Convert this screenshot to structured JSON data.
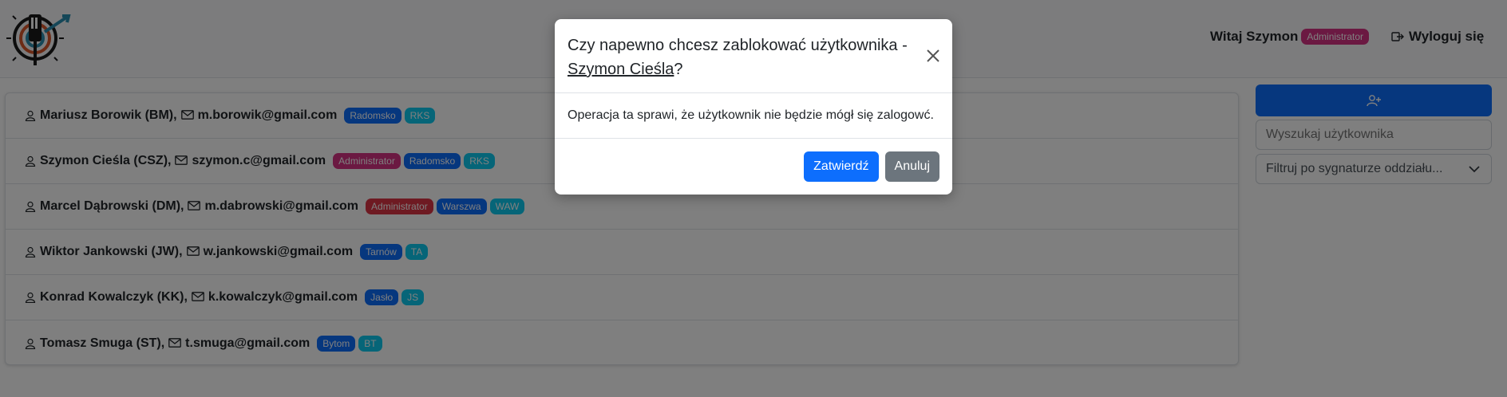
{
  "header": {
    "greeting": "Witaj Szymon",
    "role_badge": "Administrator",
    "logout_label": "Wyloguj się"
  },
  "users": [
    {
      "label": "Mariusz Borowik (BM),",
      "email": "m.borowik@gmail.com",
      "badges": [
        {
          "text": "Radomsko",
          "kind": "city"
        },
        {
          "text": "RKS",
          "kind": "code"
        }
      ]
    },
    {
      "label": "Szymon Cieśla (CSZ),",
      "email": "szymon.c@gmail.com",
      "badges": [
        {
          "text": "Administrator",
          "kind": "admin"
        },
        {
          "text": "Radomsko",
          "kind": "city"
        },
        {
          "text": "RKS",
          "kind": "code"
        }
      ]
    },
    {
      "label": "Marcel Dąbrowski (DM),",
      "email": "m.dabrowski@gmail.com",
      "badges": [
        {
          "text": "Administrator",
          "kind": "admin2"
        },
        {
          "text": "Warszwa",
          "kind": "city"
        },
        {
          "text": "WAW",
          "kind": "code"
        }
      ]
    },
    {
      "label": "Wiktor Jankowski (JW),",
      "email": "w.jankowski@gmail.com",
      "badges": [
        {
          "text": "Tarnów",
          "kind": "city"
        },
        {
          "text": "TA",
          "kind": "code"
        }
      ]
    },
    {
      "label": "Konrad Kowalczyk (KK),",
      "email": "k.kowalczyk@gmail.com",
      "badges": [
        {
          "text": "Jasło",
          "kind": "city"
        },
        {
          "text": "JS",
          "kind": "code"
        }
      ]
    },
    {
      "label": "Tomasz Smuga (ST),",
      "email": "t.smuga@gmail.com",
      "badges": [
        {
          "text": "Bytom",
          "kind": "city"
        },
        {
          "text": "BT",
          "kind": "code"
        }
      ]
    }
  ],
  "sidebar": {
    "add_icon": "user-plus-icon",
    "search_placeholder": "Wyszukaj użytkownika",
    "filter_label": "Filtruj po sygnaturze oddziału..."
  },
  "modal": {
    "title_prefix": "Czy napewno chcesz zablokować użytkownika -",
    "title_user": "Szymon Cieśla",
    "title_suffix": "?",
    "body": "Operacja ta sprawi, że użytkownik nie będzie mógł się zalogowć.",
    "confirm_label": "Zatwierdź",
    "cancel_label": "Anuluj"
  },
  "colors": {
    "primary": "#0d6efd",
    "secondary": "#6c757d",
    "admin_badge": "#d63384",
    "city_badge": "#0d6efd",
    "code_badge": "#0dcaf0"
  }
}
